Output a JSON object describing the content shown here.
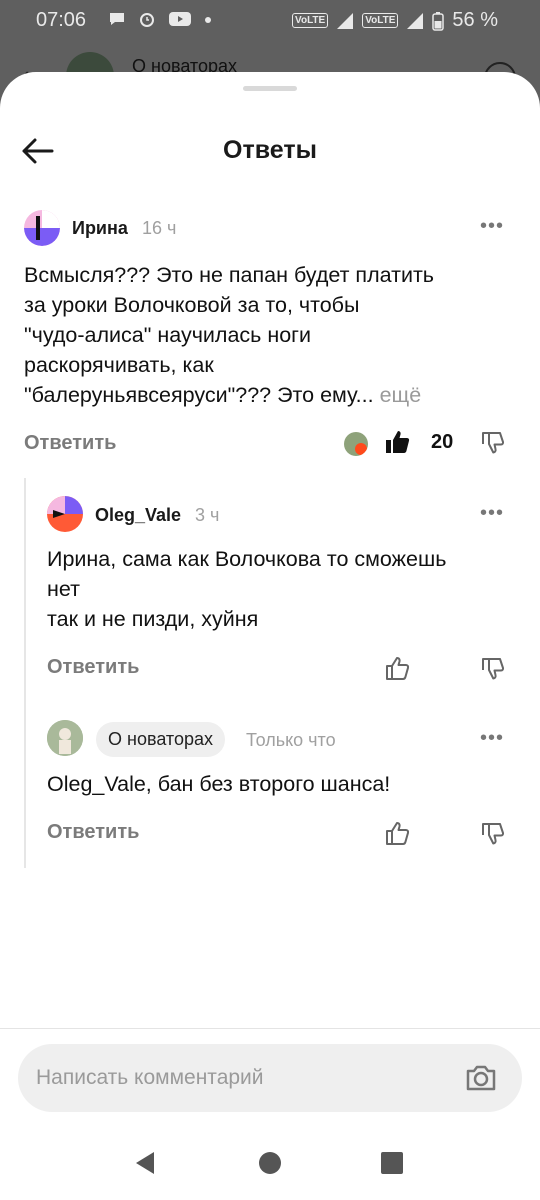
{
  "status": {
    "time": "07:06",
    "battery": "56 %",
    "volte_1": "VoLTE",
    "volte_2": "VoLTE"
  },
  "background": {
    "channel_title": "О новаторах"
  },
  "sheet": {
    "title": "Ответы"
  },
  "comments": [
    {
      "author": "Ирина",
      "time": "16 ч",
      "text_lines": [
        "Всмысля???  Это не папан будет платить",
        "за уроки Волочковой за то, чтобы",
        "\"чудо-алиса\" научилась ноги",
        "раскорячивать, как",
        "\"балеруньявсеяруси\"??? Это ему..."
      ],
      "more_label": "ещё",
      "reply_label": "Ответить",
      "likes": "20"
    },
    {
      "author": "Oleg_Vale",
      "time": "3 ч",
      "text_lines": [
        "Ирина, сама как Волочкова то сможешь",
        "нет",
        "так и не пизди, хуйня"
      ],
      "reply_label": "Ответить"
    },
    {
      "author": "О новаторах",
      "time": "Только что",
      "text_lines": [
        "Oleg_Vale, бан без второго шанса!"
      ],
      "reply_label": "Ответить"
    }
  ],
  "input": {
    "placeholder": "Написать комментарий"
  },
  "icons": {
    "back": "back-arrow-icon",
    "more": "more-dots-icon",
    "like": "thumb-up-icon",
    "dislike": "thumb-down-icon",
    "camera": "camera-icon",
    "nav_back": "nav-back-icon",
    "nav_home": "nav-home-icon",
    "nav_recents": "nav-recents-icon"
  },
  "colors": {
    "accent_purple": "#7b5cf5",
    "accent_orange": "#ff5a36",
    "avatar_pink": "#f5b8e0"
  }
}
